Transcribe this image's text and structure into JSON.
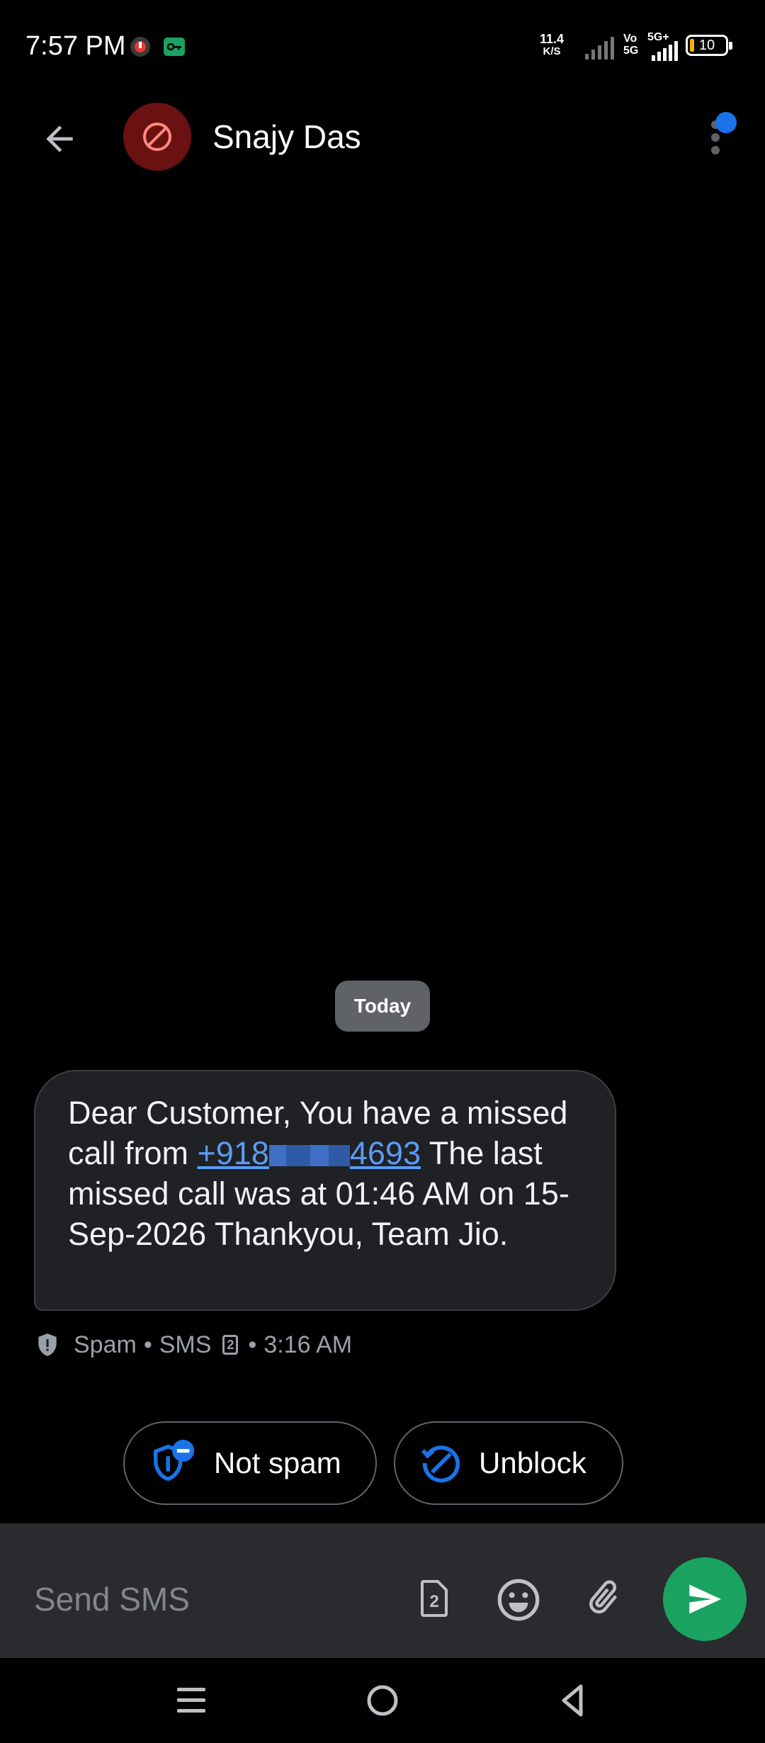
{
  "status_bar": {
    "time": "7:57 PM",
    "net_speed_value": "11.4",
    "net_speed_unit": "K/S",
    "network_labels": [
      "Vo",
      "5G",
      "5G+"
    ],
    "battery": "10"
  },
  "header": {
    "contact_name": "Snajy Das",
    "avatar_icon": "blocked-icon"
  },
  "conversation": {
    "date_chip": "Today",
    "message": {
      "text_before_link": "Dear Customer, You have a missed call from ",
      "link_prefix": "+918",
      "link_suffix": "4693",
      "text_after_link": " The last missed call was at 01:46 AM on 15-Sep-2026 Thankyou, Team Jio.",
      "meta_spam": "Spam",
      "meta_type": "SMS",
      "meta_sim": "2",
      "meta_time": "3:16 AM"
    }
  },
  "actions": {
    "not_spam": "Not spam",
    "unblock": "Unblock"
  },
  "composer": {
    "placeholder": "Send SMS",
    "sim": "2"
  },
  "colors": {
    "accent_blue": "#1a73e8",
    "send_green": "#1aa260",
    "avatar_red": "#6b1111"
  }
}
